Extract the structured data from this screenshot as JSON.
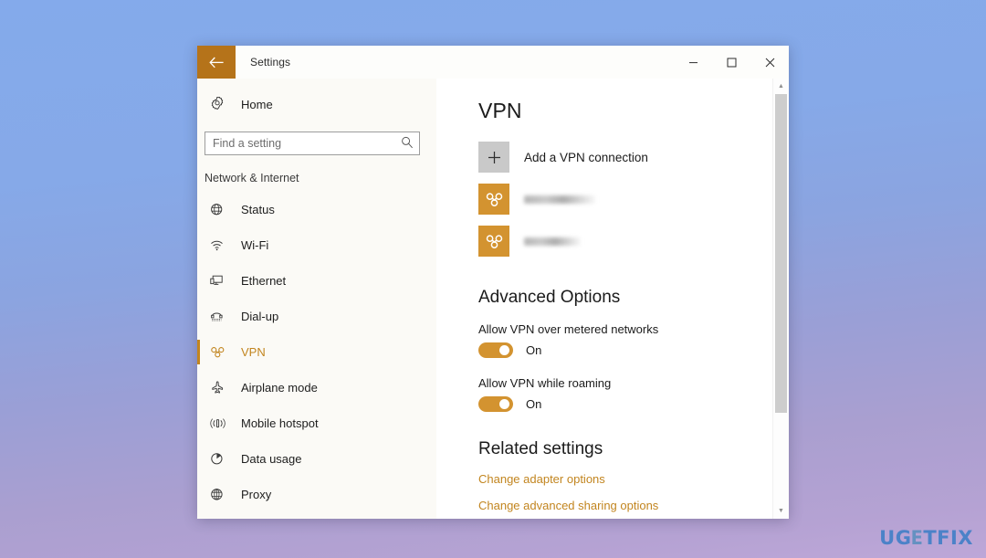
{
  "window": {
    "title": "Settings",
    "back_label": "Back",
    "controls": {
      "minimize": "─",
      "maximize": "☐",
      "close": "✕"
    }
  },
  "sidebar": {
    "home": {
      "label": "Home",
      "icon": "gear-icon"
    },
    "search": {
      "placeholder": "Find a setting",
      "value": "",
      "icon": "search-icon"
    },
    "group_heading": "Network & Internet",
    "items": [
      {
        "label": "Status",
        "icon": "globe-status-icon",
        "selected": false
      },
      {
        "label": "Wi-Fi",
        "icon": "wifi-icon",
        "selected": false
      },
      {
        "label": "Ethernet",
        "icon": "ethernet-icon",
        "selected": false
      },
      {
        "label": "Dial-up",
        "icon": "dialup-phone-icon",
        "selected": false
      },
      {
        "label": "VPN",
        "icon": "vpn-knot-icon",
        "selected": true
      },
      {
        "label": "Airplane mode",
        "icon": "airplane-icon",
        "selected": false
      },
      {
        "label": "Mobile hotspot",
        "icon": "hotspot-icon",
        "selected": false
      },
      {
        "label": "Data usage",
        "icon": "pie-chart-icon",
        "selected": false
      },
      {
        "label": "Proxy",
        "icon": "globe-proxy-icon",
        "selected": false
      }
    ]
  },
  "content": {
    "page_title": "VPN",
    "add_connection": {
      "label": "Add a VPN connection",
      "icon": "plus-icon"
    },
    "connections": [
      {
        "name": "",
        "redacted": true,
        "icon": "vpn-knot-icon"
      },
      {
        "name": "",
        "redacted": true,
        "icon": "vpn-knot-icon"
      }
    ],
    "advanced": {
      "title": "Advanced Options",
      "options": [
        {
          "label": "Allow VPN over metered networks",
          "state": "On",
          "on": true
        },
        {
          "label": "Allow VPN while roaming",
          "state": "On",
          "on": true
        }
      ]
    },
    "related": {
      "title": "Related settings",
      "links": [
        "Change adapter options",
        "Change advanced sharing options"
      ]
    }
  },
  "scrollbar": {
    "up": "▲",
    "down": "▼"
  },
  "watermark": {
    "part1": "UG",
    "accent": "E",
    "part2": "TFIX"
  },
  "colors": {
    "accent_orange": "#c2851f",
    "tile_orange": "#d39330",
    "titlebar_back": "#b5731a",
    "sidebar_bg": "#fbfaf6"
  }
}
